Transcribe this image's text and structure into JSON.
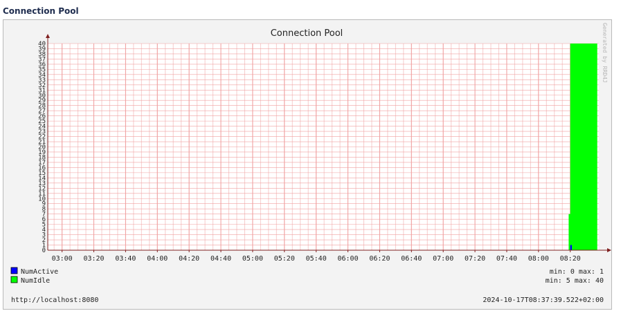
{
  "page": {
    "heading": "Connection Pool"
  },
  "chart_data": {
    "type": "area",
    "title": "Connection Pool",
    "watermark": "Generated by RRD4J",
    "x_ticks": [
      "03:00",
      "03:20",
      "03:40",
      "04:00",
      "04:20",
      "04:40",
      "05:00",
      "05:20",
      "05:40",
      "06:00",
      "06:20",
      "06:40",
      "07:00",
      "07:20",
      "07:40",
      "08:00",
      "08:20"
    ],
    "x_range": [
      "02:51",
      "08:38"
    ],
    "ylim": [
      0,
      40
    ],
    "y_ticks": [
      0,
      1,
      2,
      3,
      4,
      5,
      6,
      7,
      8,
      9,
      10,
      11,
      12,
      13,
      14,
      15,
      16,
      17,
      18,
      19,
      20,
      21,
      22,
      23,
      24,
      25,
      26,
      27,
      28,
      29,
      30,
      31,
      32,
      33,
      34,
      35,
      36,
      37,
      38,
      39,
      40
    ],
    "grid": true,
    "colors": {
      "background": "#ffffff",
      "grid": "#f0a0a0",
      "axis": "#7f1f1f",
      "num_active": "#0000ff",
      "num_idle": "#00ff00"
    },
    "series": [
      {
        "name": "NumActive",
        "color": "#0000ff",
        "min": "0",
        "max": "1",
        "points": [
          [
            "08:19",
            0
          ],
          [
            "08:20",
            1
          ],
          [
            "08:21",
            0
          ]
        ]
      },
      {
        "name": "NumIdle",
        "color": "#00ff00",
        "min": "5",
        "max": "40",
        "points": [
          [
            "08:19",
            7
          ],
          [
            "08:20",
            40
          ],
          [
            "08:37",
            40
          ]
        ]
      }
    ],
    "legend": [
      {
        "name": "NumActive",
        "stats": "min: 0  max: 1"
      },
      {
        "name": "NumIdle",
        "stats": "min: 5  max: 40"
      }
    ],
    "footer_left": "http://localhost:8080",
    "footer_right": "2024-10-17T08:37:39.522+02:00"
  }
}
